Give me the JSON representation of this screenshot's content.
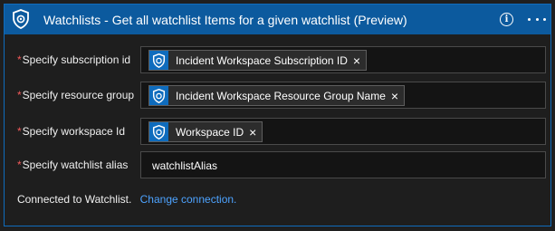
{
  "header": {
    "title": "Watchlists - Get all watchlist Items for a given watchlist (Preview)",
    "icon": "shield-watchlist-icon",
    "info_icon": "info-icon",
    "more_icon": "more-options-icon",
    "bar_color": "#0c5a9e"
  },
  "required_marker": "*",
  "fields": {
    "subscription": {
      "label": "Specify subscription id",
      "token": "Incident Workspace Subscription ID"
    },
    "resource_group": {
      "label": "Specify resource group",
      "token": "Incident Workspace Resource Group Name"
    },
    "workspace": {
      "label": "Specify workspace Id",
      "token": "Workspace ID"
    },
    "watchlist_alias": {
      "label": "Specify watchlist alias",
      "value": "watchlistAlias"
    }
  },
  "token_close_glyph": "×",
  "footer": {
    "connection_text": "Connected to Watchlist.",
    "change_link": "Change connection."
  },
  "colors": {
    "accent": "#0f6cbd",
    "link": "#4da3ff",
    "required": "#f25a5a"
  }
}
